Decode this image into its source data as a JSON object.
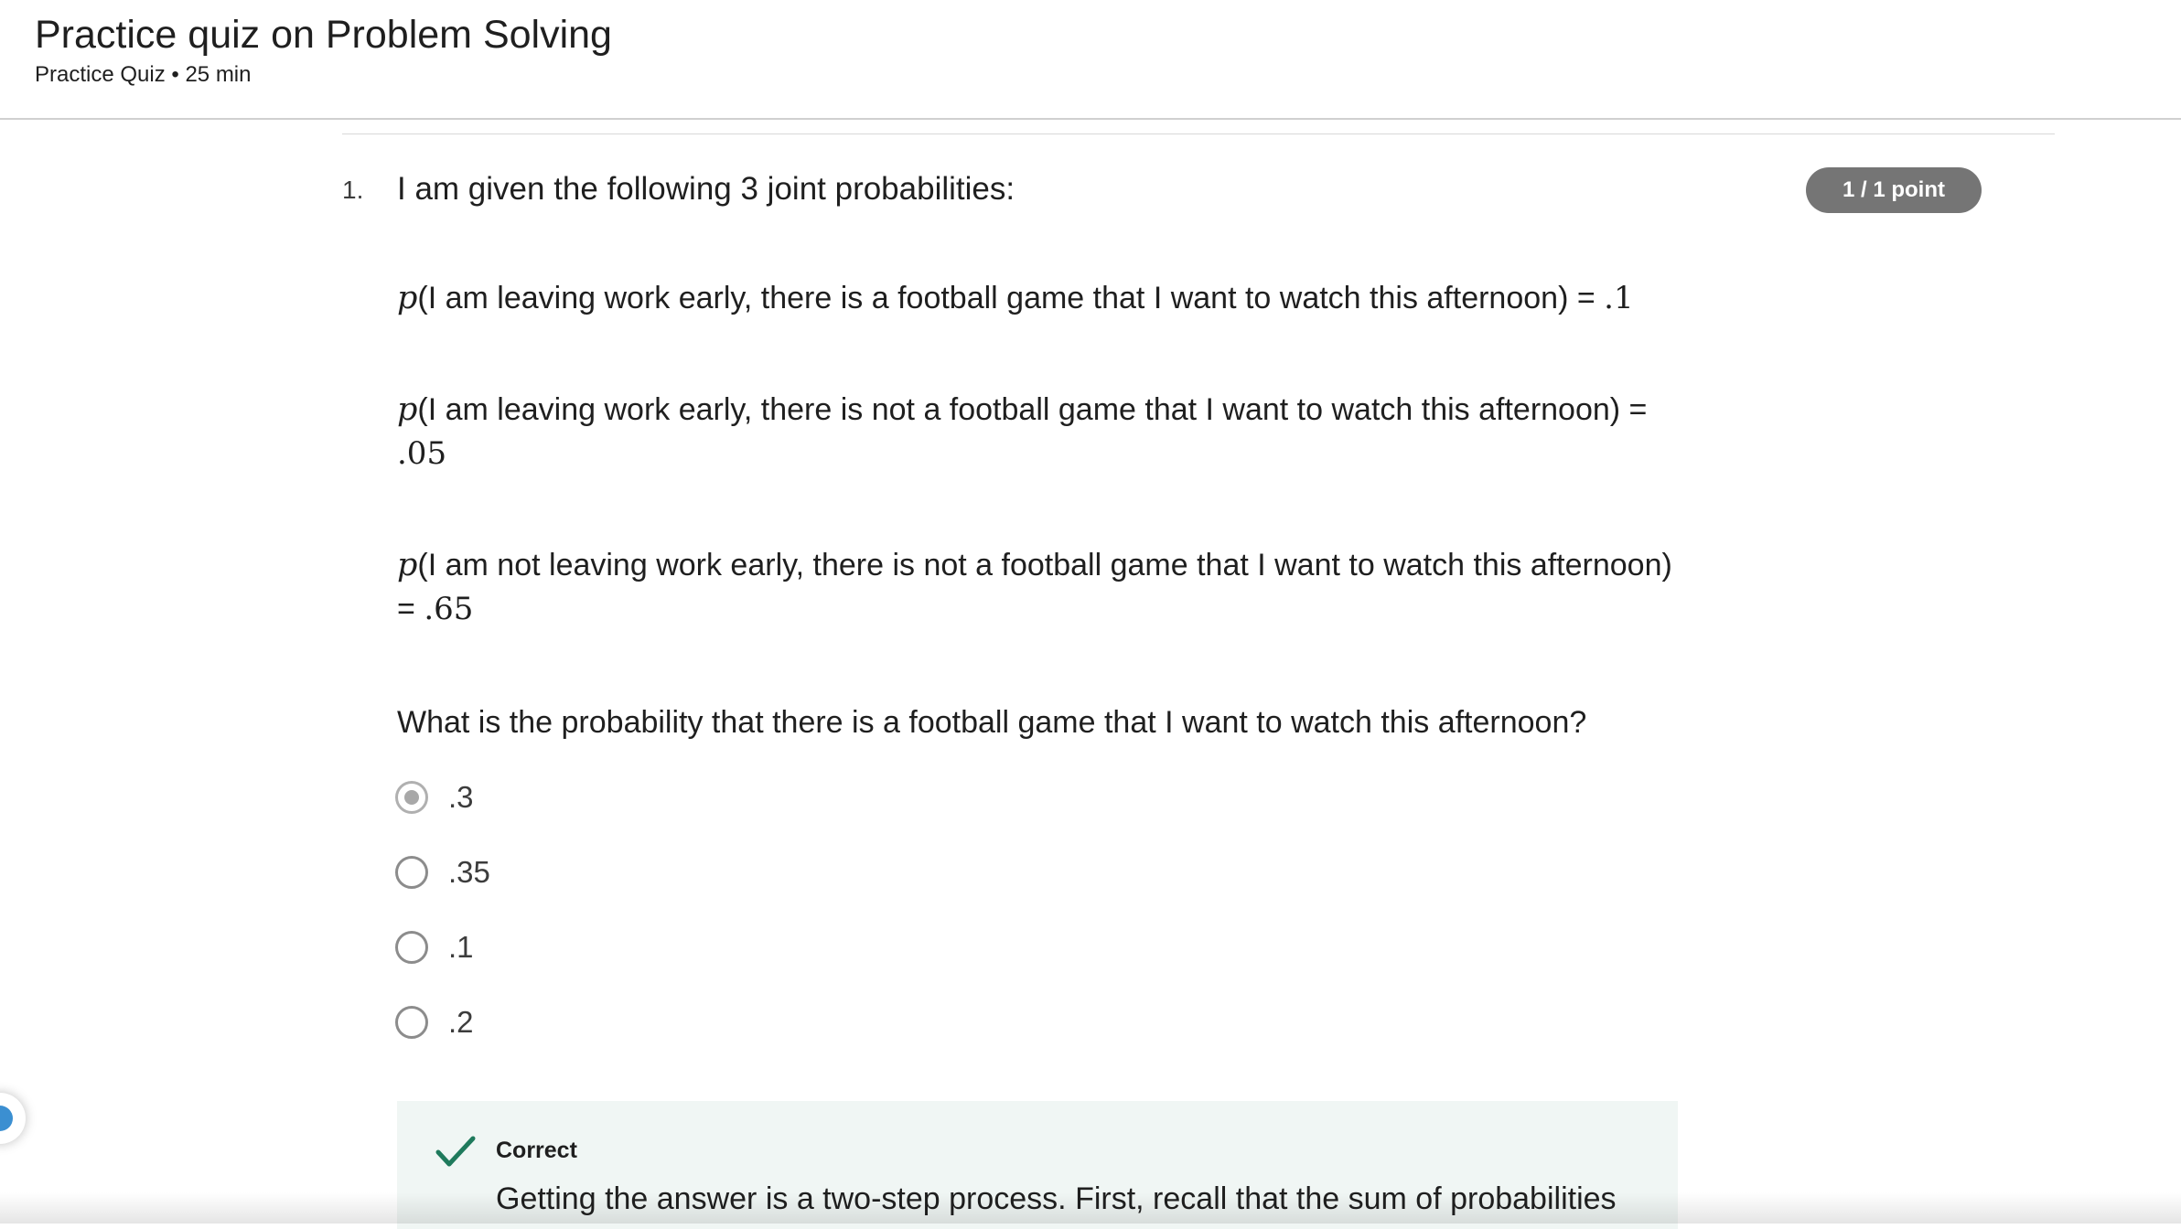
{
  "header": {
    "title": "Practice quiz on Problem Solving",
    "meta": "Practice Quiz • 25 min"
  },
  "question": {
    "number": "1.",
    "prompt": "I am given the following 3 joint probabilities:",
    "points": "1 / 1 point",
    "statements": [
      {
        "symbol": "p",
        "text": "(I am leaving work early, there is a football game that I want to watch this afternoon) = ",
        "value": ".1"
      },
      {
        "symbol": "p",
        "text": "(I am leaving work early, there is not a football game that I want to watch this afternoon) = ",
        "value": ".05"
      },
      {
        "symbol": "p",
        "text": "(I am not leaving work early, there is not a football game that I want to watch this afternoon) = ",
        "value": ".65"
      }
    ],
    "ask": "What is the probability that there is a football game that I want to watch this afternoon?",
    "options": [
      {
        "label": ".3",
        "selected": true
      },
      {
        "label": ".35",
        "selected": false
      },
      {
        "label": ".1",
        "selected": false
      },
      {
        "label": ".2",
        "selected": false
      }
    ]
  },
  "feedback": {
    "status": "Correct",
    "text": "Getting the answer is a two-step process. First, recall that the sum of probabilities"
  },
  "colors": {
    "badge": "#757575",
    "feedback_bg": "#f0f6f4",
    "check": "#1f7a5c"
  }
}
